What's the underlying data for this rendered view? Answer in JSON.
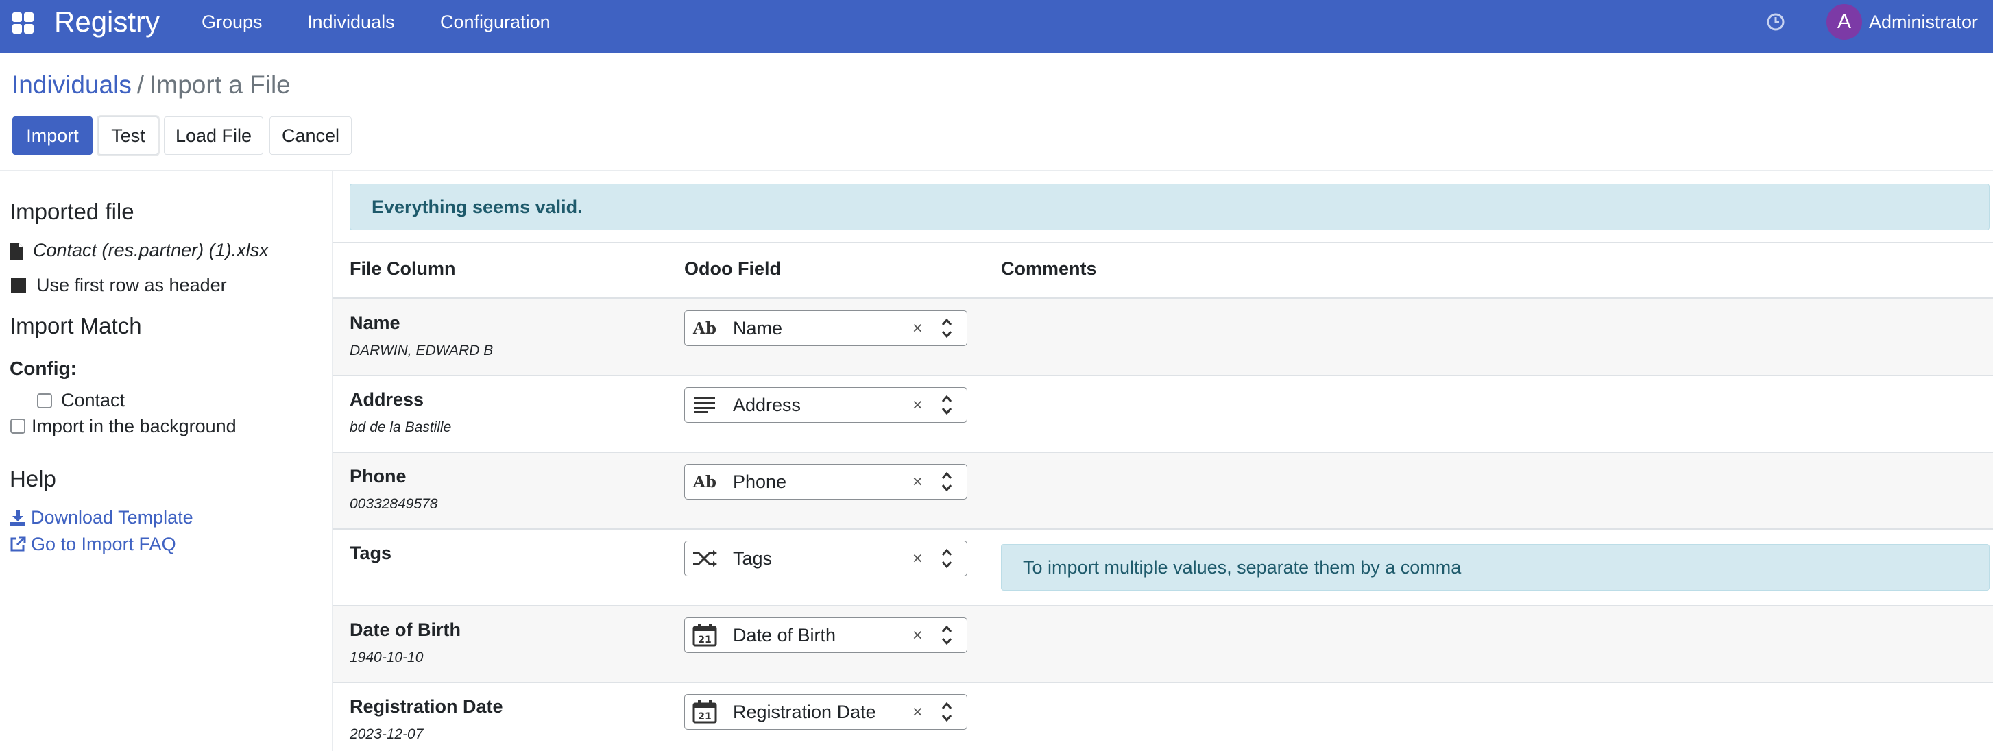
{
  "navbar": {
    "apps_icon": "grid-icon",
    "brand": "Registry",
    "menu": [
      "Groups",
      "Individuals",
      "Configuration"
    ],
    "activity_icon": "clock-icon",
    "user_initial": "A",
    "user_name": "Administrator",
    "color": "#3f62c2"
  },
  "breadcrumb": {
    "parent": "Individuals",
    "separator": "/",
    "current": "Import a File"
  },
  "actions": {
    "import": "Import",
    "test": "Test",
    "load_file": "Load File",
    "cancel": "Cancel"
  },
  "sidebar": {
    "imported_file_heading": "Imported file",
    "file_name": "Contact (res.partner) (1).xlsx",
    "first_row_header": "Use first row as header",
    "import_match_heading": "Import Match",
    "config_label": "Config:",
    "config_contact": "Contact",
    "import_background": "Import in the background",
    "help_heading": "Help",
    "download_template": "Download Template",
    "import_faq": "Go to Import FAQ"
  },
  "main": {
    "valid_message": "Everything seems valid.",
    "headers": {
      "file_column": "File Column",
      "odoo_field": "Odoo Field",
      "comments": "Comments"
    },
    "rows": [
      {
        "column": "Name",
        "sample": "DARWIN, EDWARD B",
        "field": "Name",
        "type_icon": "char-icon",
        "comment": ""
      },
      {
        "column": "Address",
        "sample": "bd de la Bastille",
        "field": "Address",
        "type_icon": "text-icon",
        "comment": ""
      },
      {
        "column": "Phone",
        "sample": "00332849578",
        "field": "Phone",
        "type_icon": "char-icon",
        "comment": ""
      },
      {
        "column": "Tags",
        "sample": "",
        "field": "Tags",
        "type_icon": "many2many-icon",
        "comment": "To import multiple values, separate them by a comma"
      },
      {
        "column": "Date of Birth",
        "sample": "1940-10-10",
        "field": "Date of Birth",
        "type_icon": "calendar-icon",
        "comment": ""
      },
      {
        "column": "Registration Date",
        "sample": "2023-12-07",
        "field": "Registration Date",
        "type_icon": "calendar-icon",
        "comment": ""
      }
    ],
    "type_icon_text": {
      "char": "Ab",
      "calendar_day": "21"
    },
    "clear_glyph": "×"
  }
}
